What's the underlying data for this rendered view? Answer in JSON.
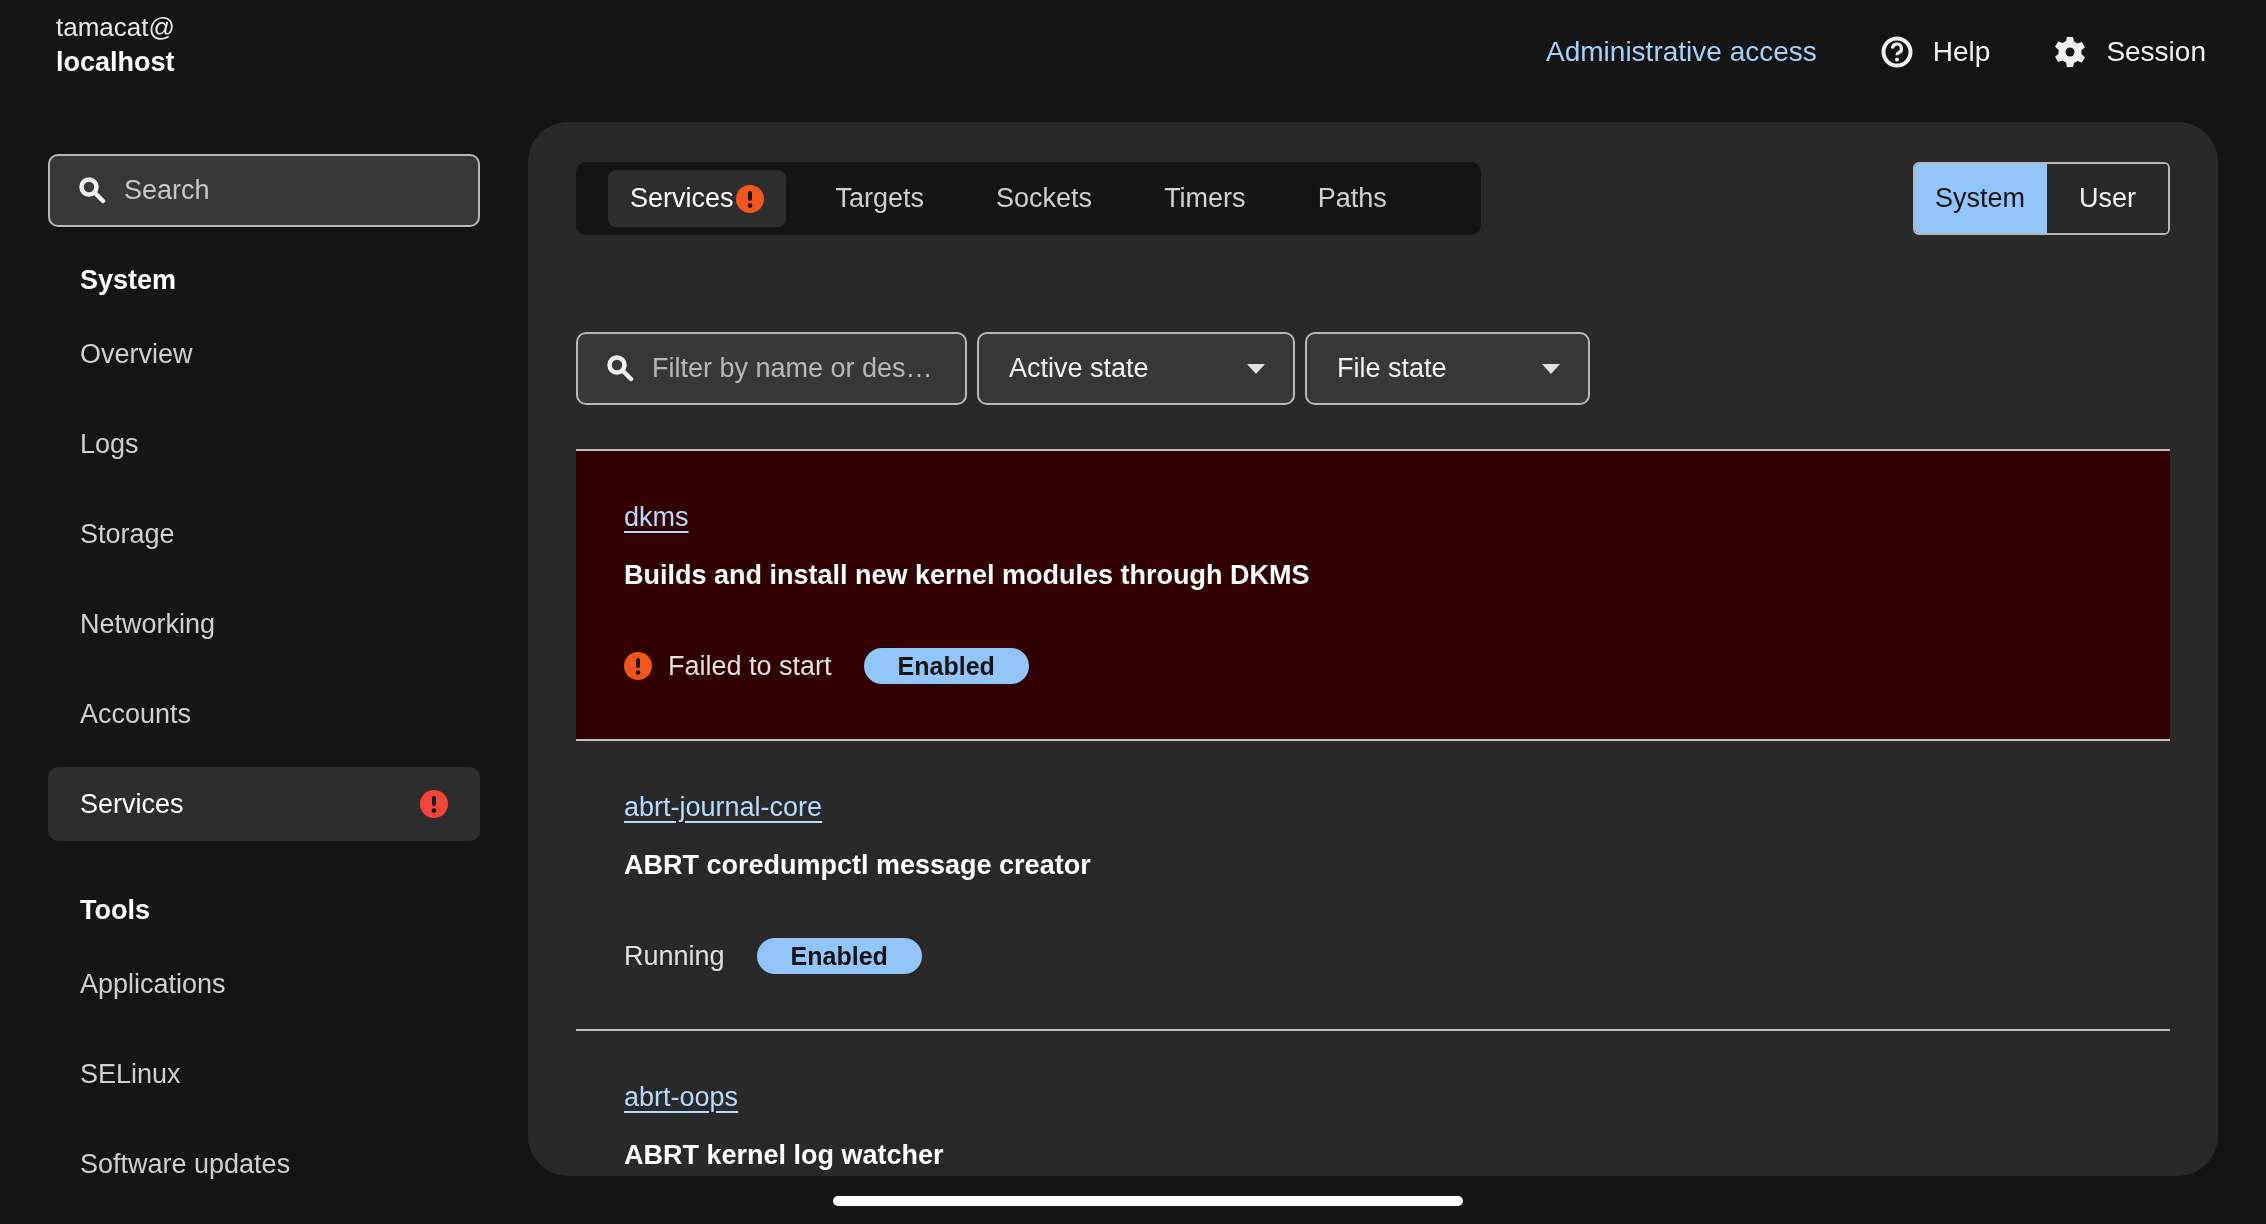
{
  "host": {
    "user": "tamacat@",
    "name": "localhost"
  },
  "header": {
    "admin_link": "Administrative access",
    "help": "Help",
    "session": "Session"
  },
  "sidebar": {
    "search": {
      "placeholder": "Search"
    },
    "sections": [
      {
        "title": "System",
        "items": [
          {
            "label": "Overview",
            "selected": false,
            "alert": false
          },
          {
            "label": "Logs",
            "selected": false,
            "alert": false
          },
          {
            "label": "Storage",
            "selected": false,
            "alert": false
          },
          {
            "label": "Networking",
            "selected": false,
            "alert": false
          },
          {
            "label": "Accounts",
            "selected": false,
            "alert": false
          },
          {
            "label": "Services",
            "selected": true,
            "alert": true
          }
        ]
      },
      {
        "title": "Tools",
        "items": [
          {
            "label": "Applications",
            "selected": false,
            "alert": false
          },
          {
            "label": "SELinux",
            "selected": false,
            "alert": false
          },
          {
            "label": "Software updates",
            "selected": false,
            "alert": false
          }
        ]
      }
    ]
  },
  "tabs": [
    {
      "label": "Services",
      "selected": true,
      "alert": true
    },
    {
      "label": "Targets",
      "selected": false,
      "alert": false
    },
    {
      "label": "Sockets",
      "selected": false,
      "alert": false
    },
    {
      "label": "Timers",
      "selected": false,
      "alert": false
    },
    {
      "label": "Paths",
      "selected": false,
      "alert": false
    }
  ],
  "scope": [
    {
      "label": "System",
      "selected": true
    },
    {
      "label": "User",
      "selected": false
    }
  ],
  "filters": {
    "search": {
      "placeholder": "Filter by name or des…"
    },
    "dropdowns": [
      "Active state",
      "File state"
    ]
  },
  "services": [
    {
      "name": "dkms",
      "description": "Builds and install new kernel modules through DKMS",
      "failed": true,
      "status": "Failed to start",
      "file_state": "Enabled"
    },
    {
      "name": "abrt-journal-core",
      "description": "ABRT coredumpctl message creator",
      "failed": false,
      "status": "Running",
      "file_state": "Enabled"
    },
    {
      "name": "abrt-oops",
      "description": "ABRT kernel log watcher"
    }
  ]
}
